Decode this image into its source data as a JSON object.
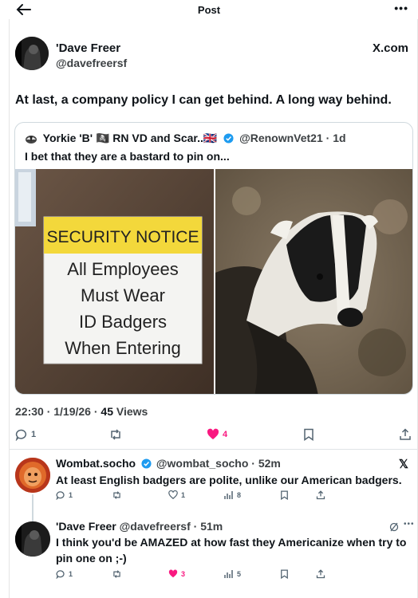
{
  "header": {
    "title": "Post"
  },
  "post": {
    "author_name": "'Dave Freer",
    "author_handle": "@davefreersf",
    "source": "X.com",
    "text": "At last, a company policy I can get behind. A long way behind.",
    "timestamp": "22:30 · 1/19/26 ·",
    "views_count": "45",
    "views_label": "Views",
    "reply_count": "1",
    "like_count": "4"
  },
  "quote": {
    "author_name": "Yorkie 'B' 🏴‍☠️ RN VD and Scar..🇬🇧",
    "handle_time": "@RenownVet21 · 1d",
    "text": "I bet that they are a bastard to pin on...",
    "sign": {
      "header": "SECURITY NOTICE",
      "line1": "All Employees",
      "line2": "Must Wear",
      "line3": "ID Badgers",
      "line4": "When Entering"
    }
  },
  "replies": [
    {
      "name": "Wombat.socho",
      "handle_time": "@wombat_socho · 52m",
      "text": "At least English badgers are polite, unlike our American badgers.",
      "reply_count": "1",
      "like_count": "1",
      "views": "8"
    },
    {
      "name": "'Dave Freer",
      "handle_time": "@davefreersf · 51m",
      "text_line1": "I think you'd be AMAZED at how fast they Americanize when try to",
      "text_line2": "pin one on ;-)",
      "reply_count": "1",
      "like_count": "3",
      "views": "5"
    }
  ],
  "colors": {
    "like": "#f91880",
    "border": "#cfd9de",
    "muted": "#536471",
    "verified": "#1d9bf0"
  }
}
